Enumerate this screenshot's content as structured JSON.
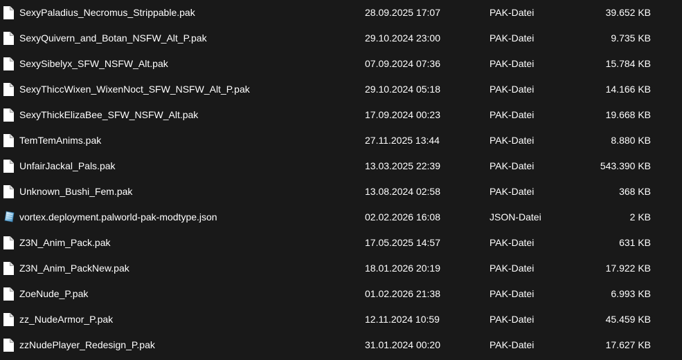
{
  "files": [
    {
      "name": "SexyPaladius_Necromus_Strippable.pak",
      "date": "28.09.2025 17:07",
      "type": "PAK-Datei",
      "size": "39.652 KB",
      "icon": "file-icon"
    },
    {
      "name": "SexyQuivern_and_Botan_NSFW_Alt_P.pak",
      "date": "29.10.2024 23:00",
      "type": "PAK-Datei",
      "size": "9.735 KB",
      "icon": "file-icon"
    },
    {
      "name": "SexySibelyx_SFW_NSFW_Alt.pak",
      "date": "07.09.2024 07:36",
      "type": "PAK-Datei",
      "size": "15.784 KB",
      "icon": "file-icon"
    },
    {
      "name": "SexyThiccWixen_WixenNoct_SFW_NSFW_Alt_P.pak",
      "date": "29.10.2024 05:18",
      "type": "PAK-Datei",
      "size": "14.166 KB",
      "icon": "file-icon"
    },
    {
      "name": "SexyThickElizaBee_SFW_NSFW_Alt.pak",
      "date": "17.09.2024 00:23",
      "type": "PAK-Datei",
      "size": "19.668 KB",
      "icon": "file-icon"
    },
    {
      "name": "TemTemAnims.pak",
      "date": "27.11.2025 13:44",
      "type": "PAK-Datei",
      "size": "8.880 KB",
      "icon": "file-icon"
    },
    {
      "name": "UnfairJackal_Pals.pak",
      "date": "13.03.2025 22:39",
      "type": "PAK-Datei",
      "size": "543.390 KB",
      "icon": "file-icon"
    },
    {
      "name": "Unknown_Bushi_Fem.pak",
      "date": "13.08.2024 02:58",
      "type": "PAK-Datei",
      "size": "368 KB",
      "icon": "file-icon"
    },
    {
      "name": "vortex.deployment.palworld-pak-modtype.json",
      "date": "02.02.2026 16:08",
      "type": "JSON-Datei",
      "size": "2 KB",
      "icon": "json-file-icon"
    },
    {
      "name": "Z3N_Anim_Pack.pak",
      "date": "17.05.2025 14:57",
      "type": "PAK-Datei",
      "size": "631 KB",
      "icon": "file-icon"
    },
    {
      "name": "Z3N_Anim_PackNew.pak",
      "date": "18.01.2026 20:19",
      "type": "PAK-Datei",
      "size": "17.922 KB",
      "icon": "file-icon"
    },
    {
      "name": "ZoeNude_P.pak",
      "date": "01.02.2026 21:38",
      "type": "PAK-Datei",
      "size": "6.993 KB",
      "icon": "file-icon"
    },
    {
      "name": "zz_NudeArmor_P.pak",
      "date": "12.11.2024 10:59",
      "type": "PAK-Datei",
      "size": "45.459 KB",
      "icon": "file-icon"
    },
    {
      "name": "zzNudePlayer_Redesign_P.pak",
      "date": "31.01.2024 00:20",
      "type": "PAK-Datei",
      "size": "17.627 KB",
      "icon": "file-icon"
    }
  ]
}
